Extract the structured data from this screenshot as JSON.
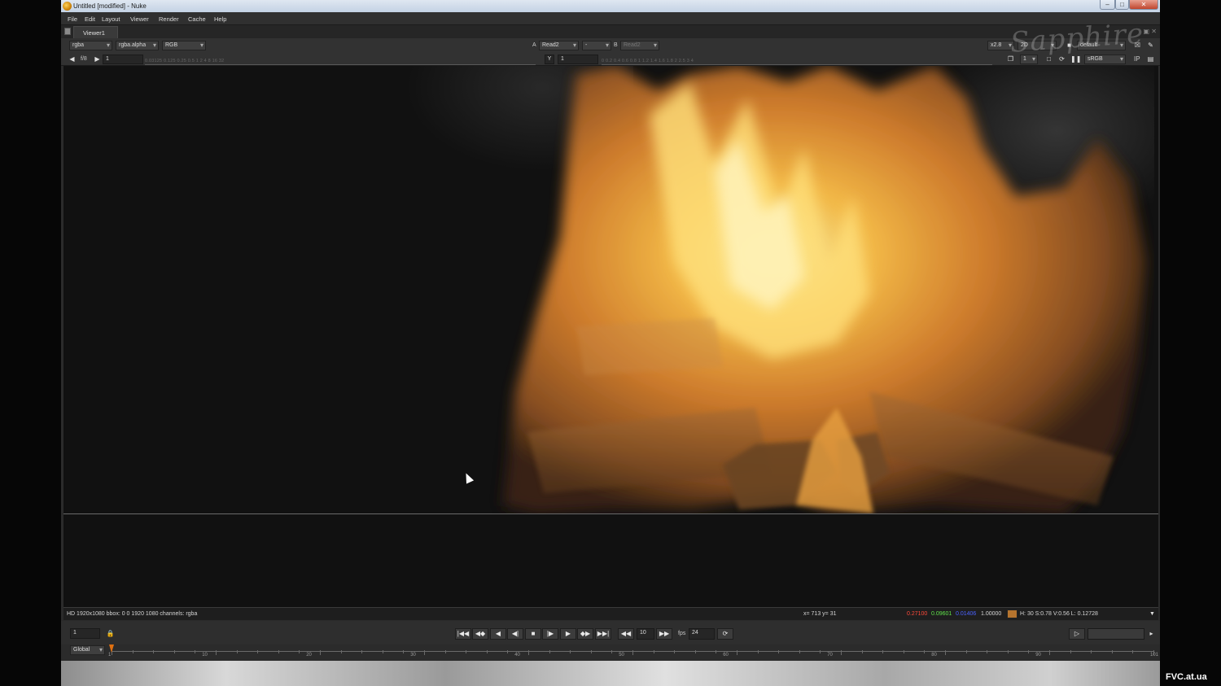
{
  "window": {
    "title": "Untitled [modified] - Nuke",
    "min_glyph": "–",
    "max_glyph": "□",
    "close_glyph": "✕"
  },
  "menu": [
    "File",
    "Edit",
    "Layout",
    "Viewer",
    "Render",
    "Cache",
    "Help"
  ],
  "viewer_tab": {
    "label": "Viewer1"
  },
  "toolbar1": {
    "channels": "rgba",
    "alpha_channel": "rgba.alpha",
    "display_channels": "RGB",
    "a_label": "A",
    "input_a": "Read2",
    "wipe_op": "-",
    "b_label": "B",
    "input_b": "Read2",
    "zoom": "x2.8",
    "view_mode": "2D",
    "lut": "default"
  },
  "toolbar2": {
    "fstop": "f/8",
    "gain": "1",
    "gamma_label": "Y",
    "gamma": "1",
    "proxy": "1",
    "colorspace": "sRGB",
    "ip_label": "IP",
    "gain_scale": "0.03125  0.125  0.25  0.5  1  2  4  8  16  32",
    "gamma_scale": "0  0.2  0.4  0.6  0.8  1  1.2  1.4  1.6  1.8  2  2.5  3  4"
  },
  "watermark": "Sapphire",
  "info": {
    "format": "HD 1920x1080 bbox: 0 0 1920 1080 channels: rgba",
    "coords": "x= 713 y=  31",
    "r": "0.27100",
    "g": "0.09601",
    "b": "0.01406",
    "a": "1.00000",
    "hsvl": "H: 30 S:0.78 V:0.56  L: 0.12728",
    "colors": {
      "r": "#ff4a3a",
      "g": "#5fe34a",
      "b": "#4a62ff",
      "a": "#e0e0e0",
      "swatch": "#b5742e"
    }
  },
  "playback": {
    "frame": "1",
    "increment": "10",
    "fps_label": "fps",
    "fps": "24",
    "range": "Global"
  },
  "timeline": {
    "start": 1,
    "end": 101,
    "current": 1,
    "labels": [
      "10",
      "20",
      "30",
      "40",
      "50",
      "60",
      "70",
      "80",
      "90",
      "101"
    ],
    "start_label": "1"
  },
  "credit": "FVC.at.ua"
}
